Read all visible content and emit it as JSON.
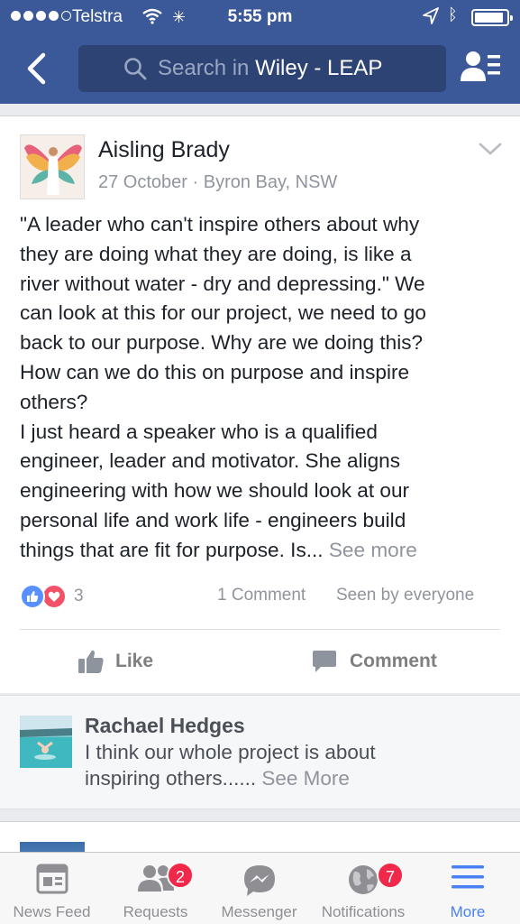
{
  "status_bar": {
    "carrier": "Telstra",
    "time": "5:55 pm"
  },
  "nav": {
    "search_prefix": "Search in",
    "search_group": "Wiley - LEAP",
    "icons": [
      "back-arrow-icon",
      "search-icon",
      "members-icon"
    ]
  },
  "post": {
    "author": "Aisling Brady",
    "date": "27 October",
    "separator": "·",
    "location": "Byron Bay, NSW",
    "text_lines": [
      "\"A leader who can't inspire others about why",
      "they are doing what they are doing, is like a",
      "river without water - dry and depressing.\" We",
      "can look at this for our project, we need to go",
      "back to our purpose. Why are we doing this?",
      "How can we do this on purpose and inspire",
      "others?",
      "I just heard a speaker who is a qualified",
      "engineer, leader and motivator. She aligns",
      "engineering with how we should look at our",
      "personal life and work life - engineers build"
    ],
    "last_line": "things that are fit for purpose. Is...",
    "see_more": "See more",
    "reaction_count": "3",
    "comment_count": "1 Comment",
    "seen_by": "Seen by everyone",
    "like_label": "Like",
    "comment_label": "Comment",
    "colors": {
      "like_blue": "#5890ff",
      "love_red": "#f25268"
    }
  },
  "comment_preview": {
    "author": "Rachael Hedges",
    "text_line1": "I think our whole project is about",
    "text_line2": "inspiring others......",
    "see_more": "See More"
  },
  "tabbar": {
    "tabs": [
      {
        "label": "News Feed",
        "icon": "news-feed-icon",
        "active": false
      },
      {
        "label": "Requests",
        "icon": "friend-requests-icon",
        "badge": "2",
        "active": false
      },
      {
        "label": "Messenger",
        "icon": "messenger-icon",
        "active": false
      },
      {
        "label": "Notifications",
        "icon": "globe-icon",
        "badge": "7",
        "active": false
      },
      {
        "label": "More",
        "icon": "menu-icon",
        "active": true
      }
    ]
  },
  "colors": {
    "header_blue": "#3b5998",
    "search_bg": "#2d4373",
    "active_tab": "#4a80f5",
    "badge_red": "#f02849"
  }
}
